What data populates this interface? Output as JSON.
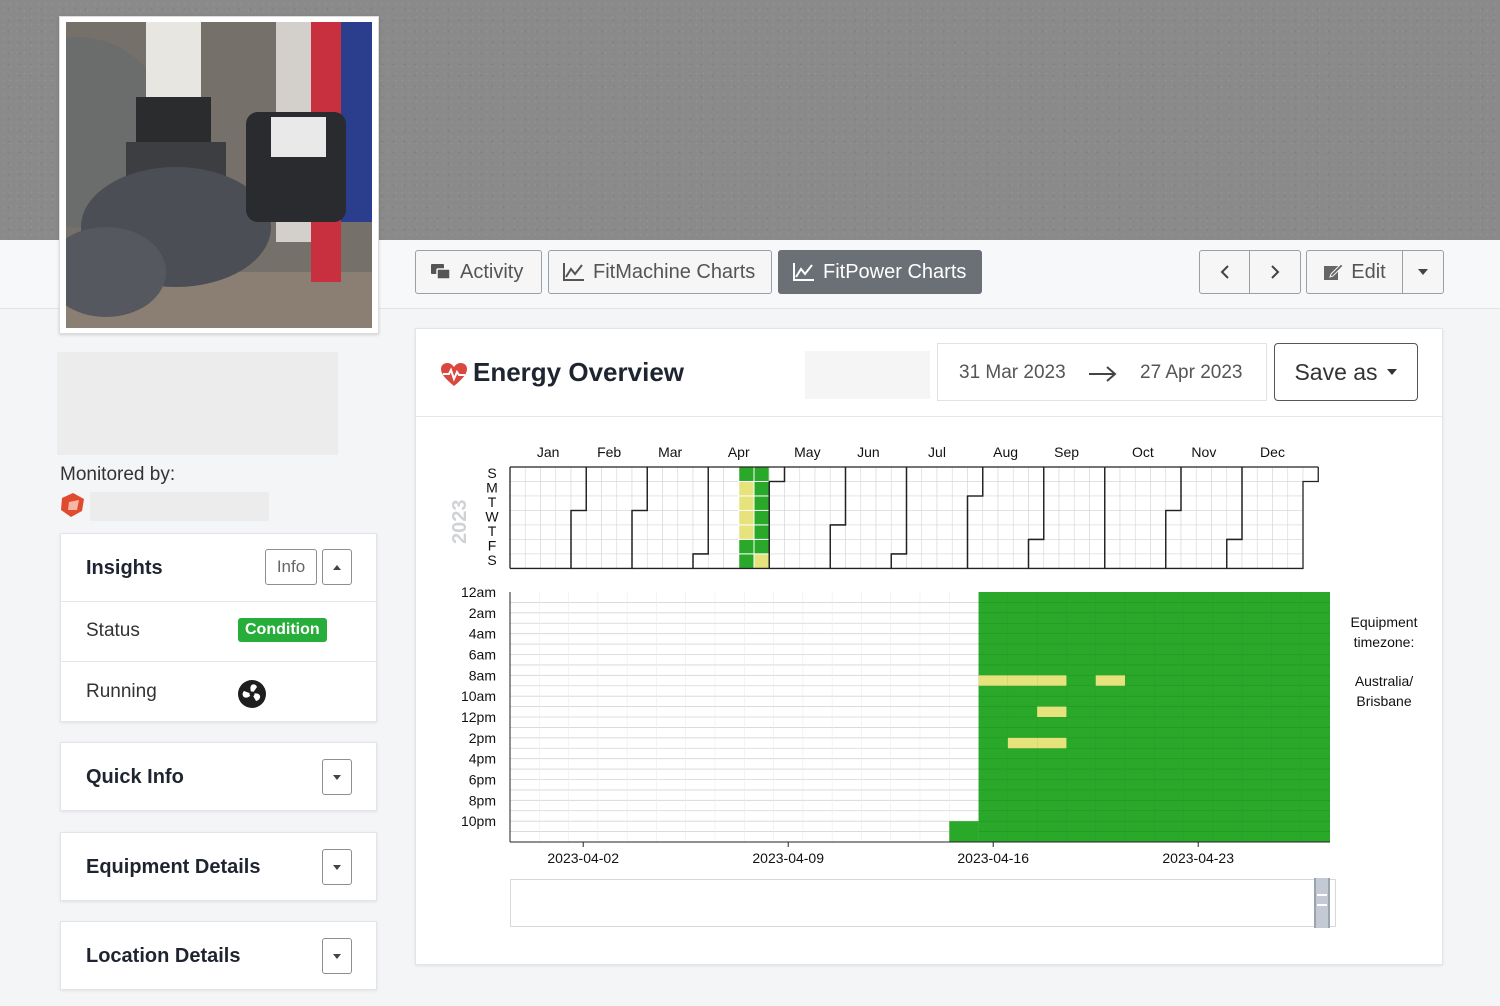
{
  "tabs": {
    "activity": "Activity",
    "fitmachine": "FitMachine Charts",
    "fitpower": "FitPower Charts"
  },
  "toolbar": {
    "edit_label": "Edit"
  },
  "sidebar": {
    "monitored_by_label": "Monitored by:",
    "insights": {
      "title": "Insights",
      "info_label": "Info",
      "status_label": "Status",
      "status_badge": "Condition",
      "running_label": "Running"
    },
    "quick_info_title": "Quick Info",
    "equipment_details_title": "Equipment Details",
    "location_details_title": "Location Details"
  },
  "panel": {
    "title": "Energy Overview",
    "date_from": "31 Mar 2023",
    "date_to": "27 Apr 2023",
    "save_as_label": "Save as",
    "timezone_caption": "Equipment timezone:",
    "timezone_value": "Australia/ Brisbane"
  },
  "colors": {
    "green": "#2aa82a",
    "yellow": "#e6e27c",
    "active_tab": "#6a7076",
    "badge_green": "#27ae3a",
    "heart_red": "#d9473f"
  },
  "chart_data": [
    {
      "type": "heatmap",
      "title": "",
      "year_label": "2023",
      "month_labels": [
        "Jan",
        "Feb",
        "Mar",
        "Apr",
        "May",
        "Jun",
        "Jul",
        "Aug",
        "Sep",
        "Oct",
        "Nov",
        "Dec"
      ],
      "weekday_labels": [
        "S",
        "M",
        "T",
        "W",
        "T",
        "F",
        "S"
      ],
      "colored_days": [
        {
          "date": "2023-04-16",
          "state": "green"
        },
        {
          "date": "2023-04-17",
          "state": "yellow"
        },
        {
          "date": "2023-04-18",
          "state": "yellow"
        },
        {
          "date": "2023-04-19",
          "state": "yellow"
        },
        {
          "date": "2023-04-20",
          "state": "yellow"
        },
        {
          "date": "2023-04-21",
          "state": "green"
        },
        {
          "date": "2023-04-22",
          "state": "green"
        },
        {
          "date": "2023-04-23",
          "state": "green"
        },
        {
          "date": "2023-04-24",
          "state": "green"
        },
        {
          "date": "2023-04-25",
          "state": "green"
        },
        {
          "date": "2023-04-26",
          "state": "green"
        },
        {
          "date": "2023-04-27",
          "state": "green"
        },
        {
          "date": "2023-04-28",
          "state": "green"
        },
        {
          "date": "2023-04-29",
          "state": "yellow"
        }
      ]
    },
    {
      "type": "heatmap",
      "title": "",
      "y_tick_labels": [
        "12am",
        "2am",
        "4am",
        "6am",
        "8am",
        "10am",
        "12pm",
        "2pm",
        "4pm",
        "6pm",
        "8pm",
        "10pm"
      ],
      "x_tick_labels": [
        "2023-04-02",
        "2023-04-09",
        "2023-04-16",
        "2023-04-23"
      ],
      "x_range": [
        "2023-03-31",
        "2023-04-27"
      ],
      "hours_per_day": 24,
      "green_from": {
        "date": "2023-04-15",
        "hour": 22
      },
      "full_green_from": "2023-04-16",
      "yellow_cells": [
        {
          "date": "2023-04-16",
          "hour": 8
        },
        {
          "date": "2023-04-17",
          "hour": 8
        },
        {
          "date": "2023-04-18",
          "hour": 8
        },
        {
          "date": "2023-04-20",
          "hour": 8
        },
        {
          "date": "2023-04-18",
          "hour": 11
        },
        {
          "date": "2023-04-17",
          "hour": 14
        },
        {
          "date": "2023-04-18",
          "hour": 14
        }
      ]
    }
  ]
}
